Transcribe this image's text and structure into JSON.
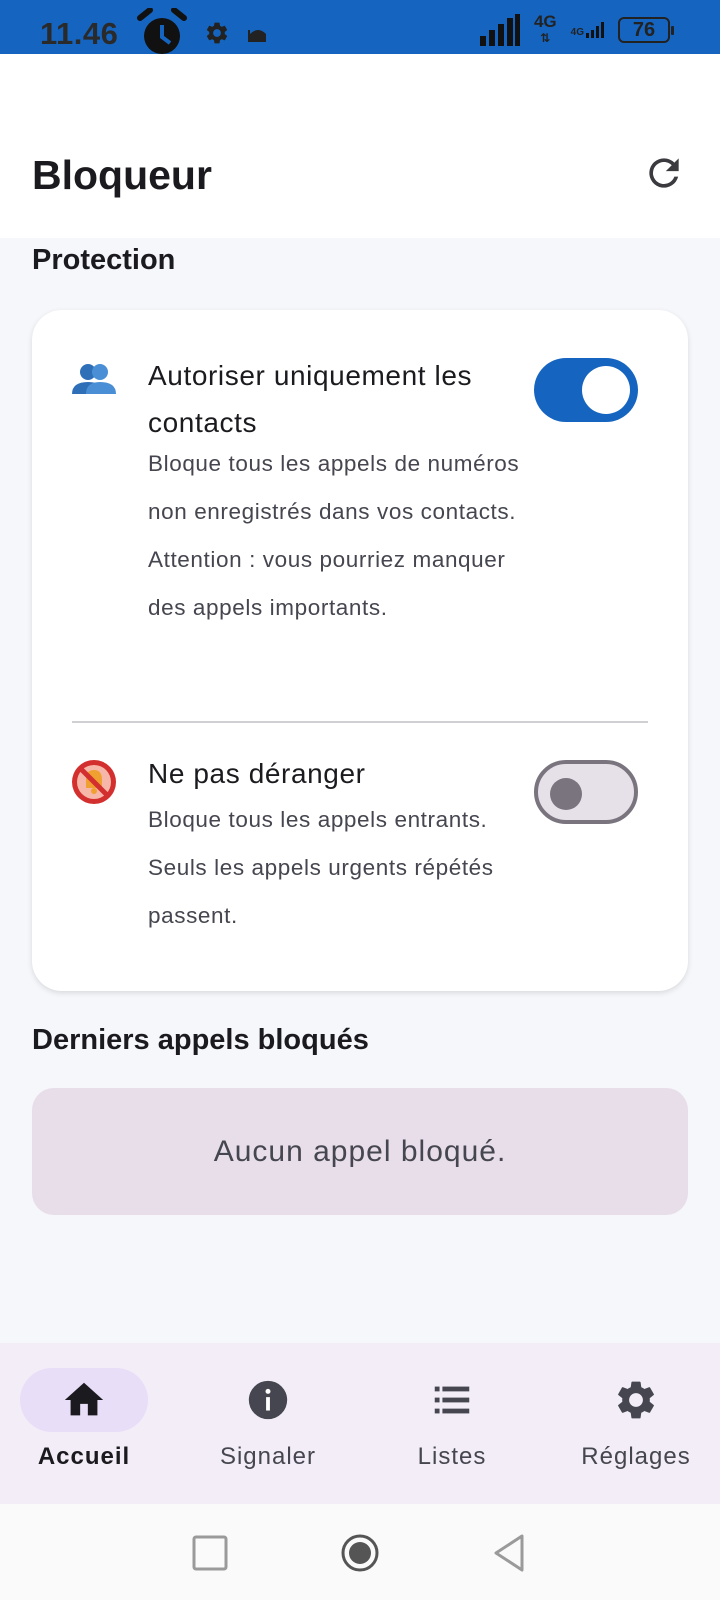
{
  "status_bar": {
    "time": "11.46",
    "network_type": "4G",
    "network_type_secondary": "4G",
    "battery": "76"
  },
  "app_bar": {
    "title": "Bloqueur",
    "refresh_icon": "refresh-icon"
  },
  "protection": {
    "section_title": "Protection",
    "options": [
      {
        "icon": "contacts-icon",
        "title": "Autoriser uniquement les contacts",
        "description": "Bloque tous les appels de numéros non enregistrés dans vos contacts. Attention : vous pourriez manquer des appels importants.",
        "enabled": true
      },
      {
        "icon": "do-not-disturb-icon",
        "title": "Ne pas déranger",
        "description": "Bloque tous les appels entrants. Seuls les appels urgents répétés passent.",
        "enabled": false
      }
    ]
  },
  "recent_blocked": {
    "section_title": "Derniers appels bloqués",
    "empty_message": "Aucun appel bloqué."
  },
  "bottom_nav": {
    "items": [
      {
        "label": "Accueil",
        "icon": "home-icon",
        "active": true
      },
      {
        "label": "Signaler",
        "icon": "info-icon",
        "active": false
      },
      {
        "label": "Listes",
        "icon": "list-icon",
        "active": false
      },
      {
        "label": "Réglages",
        "icon": "settings-icon",
        "active": false
      }
    ]
  },
  "colors": {
    "primary": "#1565c0",
    "background": "#f6f7fb",
    "surface": "#ffffff",
    "nav_background": "#f3edf7",
    "active_pill": "#e8def8",
    "empty_box": "#e7deea"
  }
}
